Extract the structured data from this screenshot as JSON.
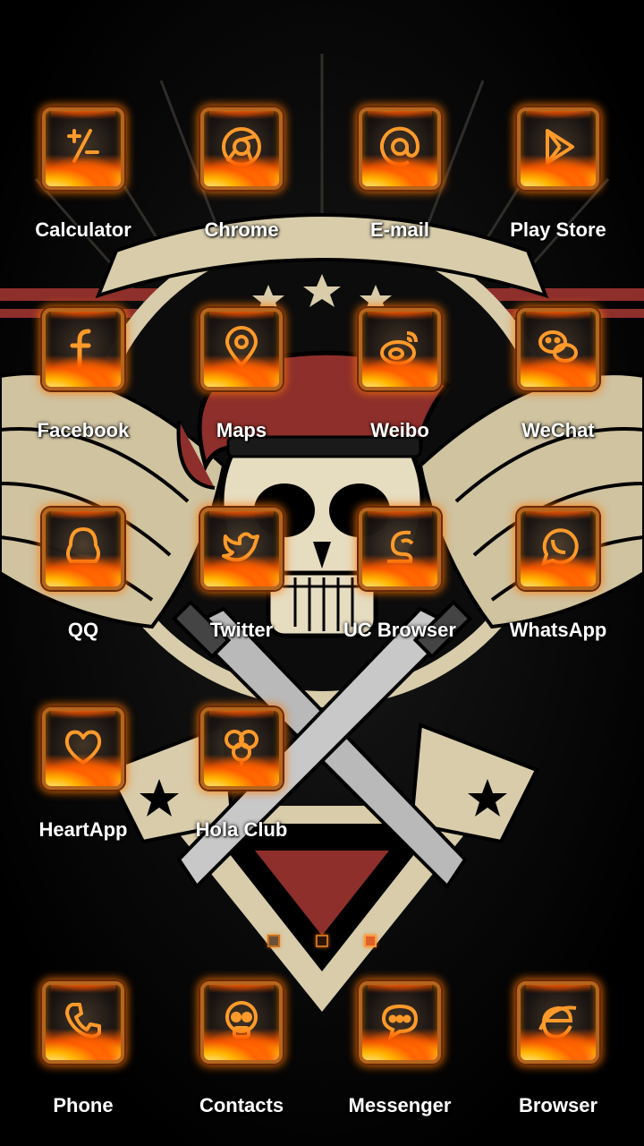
{
  "home_screen": {
    "apps": [
      {
        "label": "Calculator",
        "icon": "calculator-icon"
      },
      {
        "label": "Chrome",
        "icon": "chrome-icon"
      },
      {
        "label": "E-mail",
        "icon": "email-at-icon"
      },
      {
        "label": "Play Store",
        "icon": "play-store-icon"
      },
      {
        "label": "Facebook",
        "icon": "facebook-icon"
      },
      {
        "label": "Maps",
        "icon": "map-pin-icon"
      },
      {
        "label": "Weibo",
        "icon": "weibo-icon"
      },
      {
        "label": "WeChat",
        "icon": "wechat-icon"
      },
      {
        "label": "QQ",
        "icon": "qq-penguin-icon"
      },
      {
        "label": "Twitter",
        "icon": "twitter-bird-icon"
      },
      {
        "label": "UC Browser",
        "icon": "uc-squirrel-icon"
      },
      {
        "label": "WhatsApp",
        "icon": "whatsapp-icon"
      },
      {
        "label": "HeartApp",
        "icon": "heart-icon"
      },
      {
        "label": "Hola Club",
        "icon": "balloons-icon"
      }
    ]
  },
  "page_indicator": {
    "pages": 3,
    "current_page": 3
  },
  "dock": {
    "apps": [
      {
        "label": "Phone",
        "icon": "phone-handset-icon"
      },
      {
        "label": "Contacts",
        "icon": "skull-contact-icon"
      },
      {
        "label": "Messenger",
        "icon": "chat-bubble-icon"
      },
      {
        "label": "Browser",
        "icon": "browser-e-icon"
      }
    ]
  },
  "theme": {
    "flame_color": "#ff8c00",
    "frame_color": "#b5651d",
    "beret_red": "#8e2f2b",
    "banner_cream": "#d8ccaa"
  }
}
